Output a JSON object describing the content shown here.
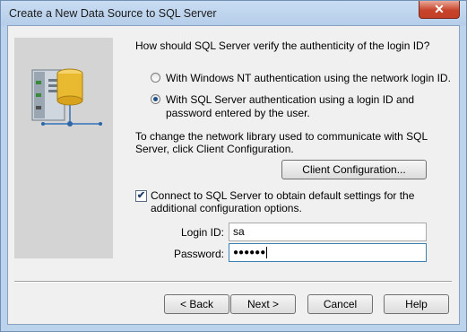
{
  "window": {
    "title": "Create a New Data Source to SQL Server",
    "close_glyph": "✕",
    "art_icon": "server-network-icon"
  },
  "auth": {
    "question": "How should SQL Server verify the authenticity of the login ID?",
    "options": [
      {
        "label": "With Windows NT authentication using the network login ID.",
        "selected": false
      },
      {
        "label": "With SQL Server authentication using a login ID and password entered by the user.",
        "selected": true
      }
    ]
  },
  "network": {
    "info": "To change the network library used to communicate with SQL Server, click Client Configuration.",
    "client_config_button": "Client Configuration..."
  },
  "connect": {
    "checked": true,
    "check_glyph": "✔",
    "label": "Connect to SQL Server to obtain default settings for the additional configuration options."
  },
  "login": {
    "login_id_label": "Login ID:",
    "login_id_value": "sa",
    "password_label": "Password:",
    "password_value": "●●●●●●"
  },
  "buttons": {
    "back": "< Back",
    "next": "Next >",
    "cancel": "Cancel",
    "help": "Help"
  }
}
